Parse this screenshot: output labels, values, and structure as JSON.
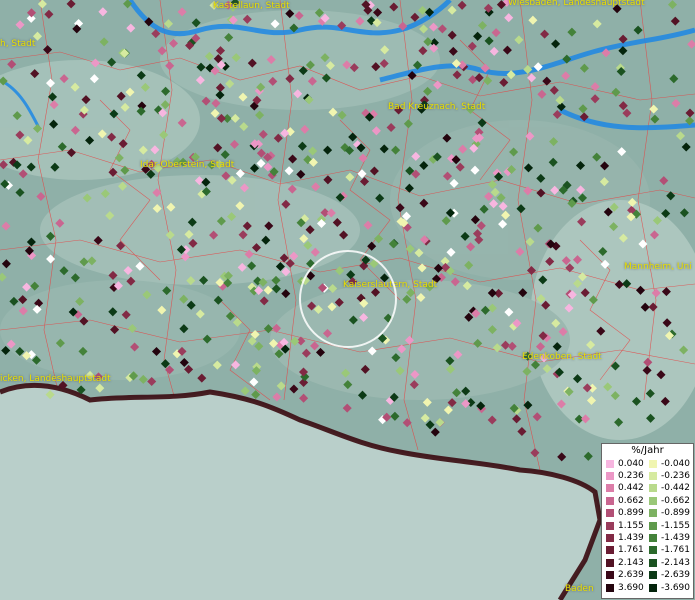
{
  "map": {
    "background_colors": {
      "land": "#8fb0a8",
      "land_light": "#b7cfc6",
      "river": "#1e88e5",
      "border": "#e84040",
      "outside": "#b9cfca",
      "frontier": "#3a0a10"
    },
    "cities": [
      {
        "id": "kastellaun",
        "label": "Kastellaun, Stadt"
      },
      {
        "id": "wiesbaden",
        "label": "Wiesbaden, Landeshauptstadt"
      },
      {
        "id": "mainz",
        "label": "h, Stadt"
      },
      {
        "id": "bad-kreuznach",
        "label": "Bad Kreuznach, Stadt"
      },
      {
        "id": "idar-oberstein",
        "label": "Idar-Oberstein, Stadt"
      },
      {
        "id": "kaiserslautern",
        "label": "Kaiserslautern, Stadt"
      },
      {
        "id": "mannheim",
        "label": "Mannheim, Uni"
      },
      {
        "id": "edenkoben",
        "label": "Edenkoben, Stadt"
      },
      {
        "id": "saarbruecken",
        "label": "icken, Landeshauptstadt"
      },
      {
        "id": "baden",
        "label": "Baden"
      }
    ]
  },
  "legend": {
    "title": "%/Jahr",
    "positive": [
      {
        "label": "0.040",
        "color": "#f7b6e0"
      },
      {
        "label": "0.236",
        "color": "#ec97c6"
      },
      {
        "label": "0.442",
        "color": "#dc7da8"
      },
      {
        "label": "0.662",
        "color": "#c96690"
      },
      {
        "label": "0.899",
        "color": "#b24f75"
      },
      {
        "label": "1.155",
        "color": "#9a3c5c"
      },
      {
        "label": "1.439",
        "color": "#822a45"
      },
      {
        "label": "1.761",
        "color": "#6a1c33"
      },
      {
        "label": "2.143",
        "color": "#521224"
      },
      {
        "label": "2.639",
        "color": "#3a0818"
      },
      {
        "label": "3.690",
        "color": "#24040e"
      }
    ],
    "negative": [
      {
        "label": "-0.040",
        "color": "#f0f5b0"
      },
      {
        "label": "-0.236",
        "color": "#d6eaa0"
      },
      {
        "label": "-0.442",
        "color": "#b9da8c"
      },
      {
        "label": "-0.662",
        "color": "#9ac878"
      },
      {
        "label": "-0.899",
        "color": "#7db262"
      },
      {
        "label": "-1.155",
        "color": "#5f9a4c"
      },
      {
        "label": "-1.439",
        "color": "#44823a"
      },
      {
        "label": "-1.761",
        "color": "#2c6a2c"
      },
      {
        "label": "-2.143",
        "color": "#1a5220"
      },
      {
        "label": "-2.639",
        "color": "#0c3a16"
      },
      {
        "label": "-3.690",
        "color": "#04240c"
      }
    ]
  }
}
